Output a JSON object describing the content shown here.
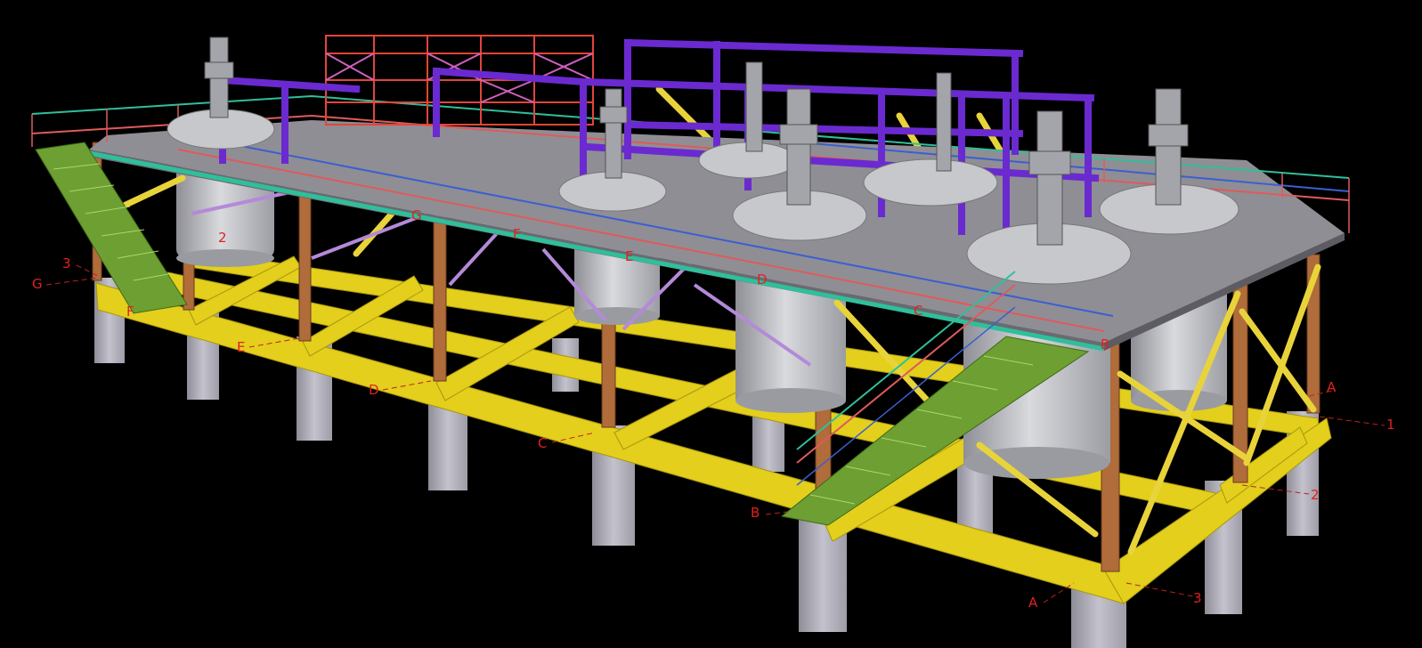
{
  "scene": {
    "background": "#000000",
    "colors": {
      "column_concrete": "#b4b2bd",
      "column_concrete_dark": "#8f8d98",
      "ground_beam": "#e6d21c",
      "ground_beam_dark": "#b9a614",
      "steel_column": "#b06c3a",
      "brace": "#e8d43a",
      "platform_deck": "#8f8e95",
      "platform_deck_dark": "#6b6a71",
      "handrail_red": "#e05a5a",
      "handrail_teal": "#2fbf9b",
      "handrail_blue": "#3a5fd0",
      "purple_frame": "#6a2ad0",
      "scaffold_red": "#e2453a",
      "scaffold_pink": "#d060c0",
      "tank": "#c7c8cc",
      "tank_dark": "#9a9ba0",
      "stair_green": "#7ab83a",
      "grid_label": "#e0221e"
    },
    "grid_labels": {
      "g_left": "G",
      "num3_left": "3",
      "f_left": "F",
      "e_front": "E",
      "d_front": "D",
      "c_front": "C",
      "b_front": "B",
      "a_front": "A",
      "a_right": "A",
      "num1_right": "1",
      "num2_right": "2",
      "num3_front": "3",
      "num2_tank": "2",
      "g_deck": "G",
      "f_deck": "F",
      "e_deck": "E",
      "d_deck": "D",
      "c_deck": "C",
      "b_deck": "B"
    }
  }
}
